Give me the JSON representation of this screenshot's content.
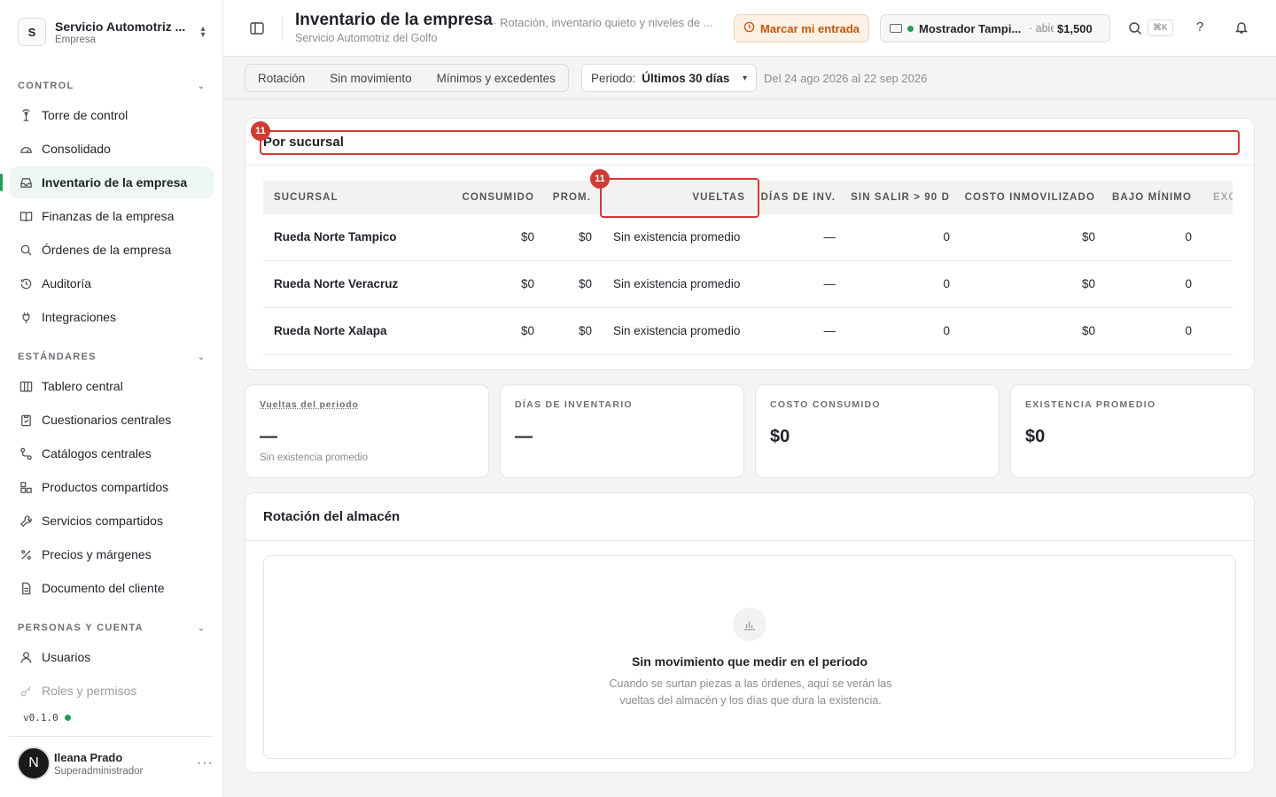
{
  "workspace": {
    "name": "Servicio Automotriz ...",
    "type": "Empresa",
    "avatar": "S"
  },
  "sidebar": {
    "sections": [
      {
        "title": "CONTROL"
      },
      {
        "title": "ESTÁNDARES"
      },
      {
        "title": "PERSONAS Y CUENTA"
      }
    ],
    "control_items": [
      {
        "label": "Torre de control",
        "icon": "tower-icon"
      },
      {
        "label": "Consolidado",
        "icon": "gauge-icon"
      },
      {
        "label": "Inventario de la empresa",
        "icon": "inbox-icon",
        "active": true
      },
      {
        "label": "Finanzas de la empresa",
        "icon": "book-icon"
      },
      {
        "label": "Órdenes de la empresa",
        "icon": "search-icon"
      },
      {
        "label": "Auditoría",
        "icon": "history-icon"
      },
      {
        "label": "Integraciones",
        "icon": "plug-icon"
      }
    ],
    "standards_items": [
      {
        "label": "Tablero central",
        "icon": "columns-icon"
      },
      {
        "label": "Cuestionarios centrales",
        "icon": "clipboard-icon"
      },
      {
        "label": "Catálogos centrales",
        "icon": "route-icon"
      },
      {
        "label": "Productos compartidos",
        "icon": "boxes-icon"
      },
      {
        "label": "Servicios compartidos",
        "icon": "wrench-icon"
      },
      {
        "label": "Precios y márgenes",
        "icon": "percent-icon"
      },
      {
        "label": "Documento del cliente",
        "icon": "document-icon"
      }
    ],
    "people_items": [
      {
        "label": "Usuarios",
        "icon": "user-icon"
      },
      {
        "label": "Roles y permisos",
        "icon": "key-icon"
      }
    ],
    "version": "v0.1.0",
    "user": {
      "name": "Ileana Prado",
      "role": "Superadministrador",
      "initial": "N"
    }
  },
  "header": {
    "title": "Inventario de la empresa",
    "subtitle": "Servicio Automotriz del Golfo",
    "description": "· Rotación, inventario quieto y niveles de ...",
    "clock_in_label": "Marcar mi entrada",
    "register": {
      "name": "Mostrador Tampi...",
      "state": "· abie",
      "amount": "$1,500"
    },
    "shortcut": "⌘K",
    "help": "?"
  },
  "toolbar": {
    "tabs": [
      "Rotación",
      "Sin movimiento",
      "Mínimos y excedentes"
    ],
    "period_label": "Periodo:",
    "period_value": "Últimos 30 días",
    "range": "Del 24 ago 2026 al 22 sep 2026"
  },
  "branch_table": {
    "title": "Por sucursal",
    "badge": "11",
    "columns": [
      "SUCURSAL",
      "CONSUMIDO",
      "PROM.",
      "VUELTAS",
      "DÍAS DE INV.",
      "SIN SALIR > 90 D",
      "COSTO INMOVILIZADO",
      "BAJO MÍNIMO",
      "EXC"
    ],
    "rows": [
      [
        "Rueda Norte Tampico",
        "$0",
        "$0",
        "Sin existencia promedio",
        "—",
        "0",
        "$0",
        "0"
      ],
      [
        "Rueda Norte Veracruz",
        "$0",
        "$0",
        "Sin existencia promedio",
        "—",
        "0",
        "$0",
        "0"
      ],
      [
        "Rueda Norte Xalapa",
        "$0",
        "$0",
        "Sin existencia promedio",
        "—",
        "0",
        "$0",
        "0"
      ]
    ]
  },
  "stats": [
    {
      "label": "Vueltas del periodo",
      "value": "—",
      "note": "Sin existencia promedio"
    },
    {
      "label": "DÍAS DE INVENTARIO",
      "value": "—",
      "note": ""
    },
    {
      "label": "COSTO CONSUMIDO",
      "value": "$0",
      "note": ""
    },
    {
      "label": "EXISTENCIA PROMEDIO",
      "value": "$0",
      "note": ""
    }
  ],
  "rotation": {
    "title": "Rotación del almacén",
    "empty_title": "Sin movimiento que medir en el periodo",
    "empty_text": "Cuando se surtan piezas a las órdenes, aquí se verán las vueltas del almacén y los días que dura la existencia."
  },
  "colors": {
    "accent": "#1f9d55",
    "highlight": "#d03a35",
    "warning": "#c2570c"
  }
}
